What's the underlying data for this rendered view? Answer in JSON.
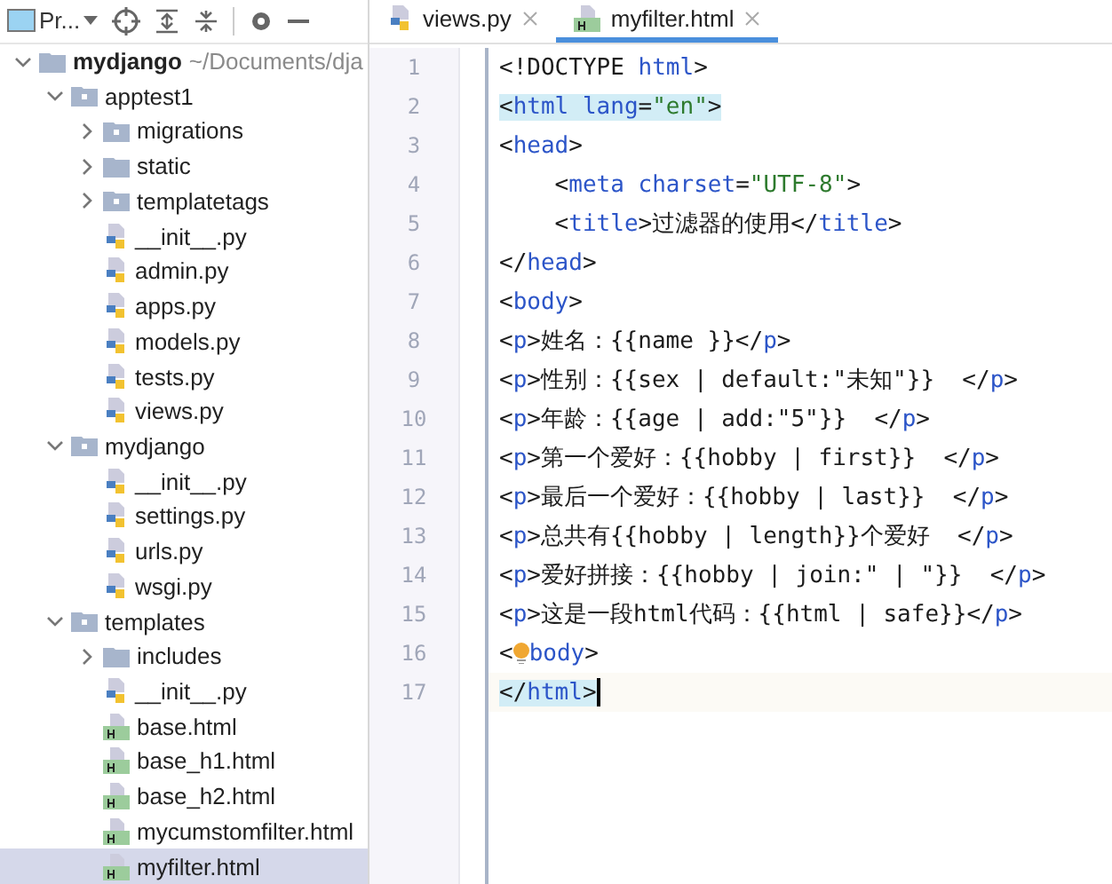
{
  "toolbar": {
    "project_label": "Pr..."
  },
  "tree": [
    {
      "name": "mydjango",
      "path": "~/Documents/dja",
      "kind": "root",
      "expanded": true,
      "selected": false,
      "children": [
        {
          "name": "apptest1",
          "kind": "folder",
          "expanded": true,
          "selected": false,
          "children": [
            {
              "name": "migrations",
              "kind": "folder",
              "expanded": false,
              "selected": false
            },
            {
              "name": "static",
              "kind": "plainfolder",
              "expanded": false,
              "selected": false
            },
            {
              "name": "templatetags",
              "kind": "folder",
              "expanded": false,
              "selected": false
            },
            {
              "name": "__init__.py",
              "kind": "py",
              "selected": false
            },
            {
              "name": "admin.py",
              "kind": "py",
              "selected": false
            },
            {
              "name": "apps.py",
              "kind": "py",
              "selected": false
            },
            {
              "name": "models.py",
              "kind": "py",
              "selected": false
            },
            {
              "name": "tests.py",
              "kind": "py",
              "selected": false
            },
            {
              "name": "views.py",
              "kind": "py",
              "selected": false
            }
          ]
        },
        {
          "name": "mydjango",
          "kind": "folder",
          "expanded": true,
          "selected": false,
          "children": [
            {
              "name": "__init__.py",
              "kind": "py",
              "selected": false
            },
            {
              "name": "settings.py",
              "kind": "py",
              "selected": false
            },
            {
              "name": "urls.py",
              "kind": "py",
              "selected": false
            },
            {
              "name": "wsgi.py",
              "kind": "py",
              "selected": false
            }
          ]
        },
        {
          "name": "templates",
          "kind": "folder",
          "expanded": true,
          "selected": false,
          "children": [
            {
              "name": "includes",
              "kind": "plainfolder",
              "expanded": false,
              "selected": false
            },
            {
              "name": "__init__.py",
              "kind": "py",
              "selected": false
            },
            {
              "name": "base.html",
              "kind": "html",
              "selected": false
            },
            {
              "name": "base_h1.html",
              "kind": "html",
              "selected": false
            },
            {
              "name": "base_h2.html",
              "kind": "html",
              "selected": false
            },
            {
              "name": "mycumstomfilter.html",
              "kind": "html",
              "selected": false
            },
            {
              "name": "myfilter.html",
              "kind": "html",
              "selected": true
            }
          ]
        }
      ]
    }
  ],
  "tabs": [
    {
      "label": "views.py",
      "kind": "py",
      "selected": false
    },
    {
      "label": "myfilter.html",
      "kind": "html",
      "selected": true
    }
  ],
  "code": [
    {
      "number": "1",
      "highlight": false,
      "tokens": [
        {
          "kind": "plain",
          "text": "<!DOCTYPE "
        },
        {
          "kind": "tag",
          "text": "html"
        },
        {
          "kind": "plain",
          "text": ">"
        }
      ]
    },
    {
      "number": "2",
      "highlight": true,
      "tokens": [
        {
          "kind": "plain",
          "text": "<"
        },
        {
          "kind": "tag",
          "text": "html lang"
        },
        {
          "kind": "plain",
          "text": "="
        },
        {
          "kind": "string",
          "text": "\"en\""
        },
        {
          "kind": "plain",
          "text": ">"
        }
      ]
    },
    {
      "number": "3",
      "highlight": false,
      "tokens": [
        {
          "kind": "plain",
          "text": "<"
        },
        {
          "kind": "tag",
          "text": "head"
        },
        {
          "kind": "plain",
          "text": ">"
        }
      ]
    },
    {
      "number": "4",
      "highlight": false,
      "tokens": [
        {
          "kind": "plain",
          "text": "    <"
        },
        {
          "kind": "tag",
          "text": "meta charset"
        },
        {
          "kind": "plain",
          "text": "="
        },
        {
          "kind": "string",
          "text": "\"UTF-8\""
        },
        {
          "kind": "plain",
          "text": ">"
        }
      ]
    },
    {
      "number": "5",
      "highlight": false,
      "tokens": [
        {
          "kind": "plain",
          "text": "    <"
        },
        {
          "kind": "tag",
          "text": "title"
        },
        {
          "kind": "plain",
          "text": ">过滤器的使用</"
        },
        {
          "kind": "tag",
          "text": "title"
        },
        {
          "kind": "plain",
          "text": ">"
        }
      ]
    },
    {
      "number": "6",
      "highlight": false,
      "tokens": [
        {
          "kind": "plain",
          "text": "</"
        },
        {
          "kind": "tag",
          "text": "head"
        },
        {
          "kind": "plain",
          "text": ">"
        }
      ]
    },
    {
      "number": "7",
      "highlight": false,
      "tokens": [
        {
          "kind": "plain",
          "text": "<"
        },
        {
          "kind": "tag",
          "text": "body"
        },
        {
          "kind": "plain",
          "text": ">"
        }
      ]
    },
    {
      "number": "8",
      "highlight": false,
      "tokens": [
        {
          "kind": "plain",
          "text": "<"
        },
        {
          "kind": "tag",
          "text": "p"
        },
        {
          "kind": "plain",
          "text": ">姓名：{{name }}</"
        },
        {
          "kind": "tag",
          "text": "p"
        },
        {
          "kind": "plain",
          "text": ">"
        }
      ]
    },
    {
      "number": "9",
      "highlight": false,
      "tokens": [
        {
          "kind": "plain",
          "text": "<"
        },
        {
          "kind": "tag",
          "text": "p"
        },
        {
          "kind": "plain",
          "text": ">性别：{{sex | default:\"未知\"}}  </"
        },
        {
          "kind": "tag",
          "text": "p"
        },
        {
          "kind": "plain",
          "text": ">"
        }
      ]
    },
    {
      "number": "10",
      "highlight": false,
      "tokens": [
        {
          "kind": "plain",
          "text": "<"
        },
        {
          "kind": "tag",
          "text": "p"
        },
        {
          "kind": "plain",
          "text": ">年龄：{{age | add:\"5\"}}  </"
        },
        {
          "kind": "tag",
          "text": "p"
        },
        {
          "kind": "plain",
          "text": ">"
        }
      ]
    },
    {
      "number": "11",
      "highlight": false,
      "tokens": [
        {
          "kind": "plain",
          "text": "<"
        },
        {
          "kind": "tag",
          "text": "p"
        },
        {
          "kind": "plain",
          "text": ">第一个爱好：{{hobby | first}}  </"
        },
        {
          "kind": "tag",
          "text": "p"
        },
        {
          "kind": "plain",
          "text": ">"
        }
      ]
    },
    {
      "number": "12",
      "highlight": false,
      "tokens": [
        {
          "kind": "plain",
          "text": "<"
        },
        {
          "kind": "tag",
          "text": "p"
        },
        {
          "kind": "plain",
          "text": ">最后一个爱好：{{hobby | last}}  </"
        },
        {
          "kind": "tag",
          "text": "p"
        },
        {
          "kind": "plain",
          "text": ">"
        }
      ]
    },
    {
      "number": "13",
      "highlight": false,
      "tokens": [
        {
          "kind": "plain",
          "text": "<"
        },
        {
          "kind": "tag",
          "text": "p"
        },
        {
          "kind": "plain",
          "text": ">总共有{{hobby | length}}个爱好  </"
        },
        {
          "kind": "tag",
          "text": "p"
        },
        {
          "kind": "plain",
          "text": ">"
        }
      ]
    },
    {
      "number": "14",
      "highlight": false,
      "tokens": [
        {
          "kind": "plain",
          "text": "<"
        },
        {
          "kind": "tag",
          "text": "p"
        },
        {
          "kind": "plain",
          "text": ">爱好拼接：{{hobby | join:\" | \"}}  </"
        },
        {
          "kind": "tag",
          "text": "p"
        },
        {
          "kind": "plain",
          "text": ">"
        }
      ]
    },
    {
      "number": "15",
      "highlight": false,
      "tokens": [
        {
          "kind": "plain",
          "text": "<"
        },
        {
          "kind": "tag",
          "text": "p"
        },
        {
          "kind": "plain",
          "text": ">这是一段html代码：{{html | safe}}</"
        },
        {
          "kind": "tag",
          "text": "p"
        },
        {
          "kind": "plain",
          "text": ">"
        }
      ]
    },
    {
      "number": "16",
      "highlight": false,
      "bulb": true,
      "tokens": [
        {
          "kind": "plain",
          "text": "<"
        },
        {
          "kind": "tag",
          "text": "body"
        },
        {
          "kind": "plain",
          "text": ">"
        }
      ]
    },
    {
      "number": "17",
      "highlight": true,
      "current": true,
      "tokens": [
        {
          "kind": "plain",
          "text": "</"
        },
        {
          "kind": "tag",
          "text": "html"
        },
        {
          "kind": "plain",
          "text": ">"
        }
      ]
    }
  ]
}
